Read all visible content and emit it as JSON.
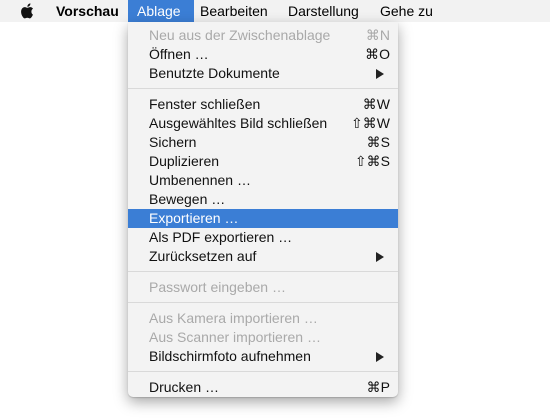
{
  "menubar": {
    "apple_icon": "apple-logo-icon",
    "app_name": "Vorschau",
    "items": [
      {
        "label": "Ablage",
        "active": true
      },
      {
        "label": "Bearbeiten",
        "active": false
      },
      {
        "label": "Darstellung",
        "active": false
      },
      {
        "label": "Gehe zu",
        "active": false
      }
    ]
  },
  "colors": {
    "highlight": "#3b7ed5",
    "menu_background": "#f3f3f3",
    "disabled_text": "#a9a9a9"
  },
  "ablage_menu": {
    "groups": [
      [
        {
          "label": "Neu aus der Zwischenablage",
          "shortcut": "⌘N",
          "enabled": false
        },
        {
          "label": "Öffnen …",
          "shortcut": "⌘O",
          "enabled": true
        },
        {
          "label": "Benutzte Dokumente",
          "submenu": true,
          "enabled": true
        }
      ],
      [
        {
          "label": "Fenster schließen",
          "shortcut": "⌘W",
          "enabled": true
        },
        {
          "label": "Ausgewähltes Bild schließen",
          "shortcut": "⇧⌘W",
          "enabled": true
        },
        {
          "label": "Sichern",
          "shortcut": "⌘S",
          "enabled": true
        },
        {
          "label": "Duplizieren",
          "shortcut": "⇧⌘S",
          "enabled": true
        },
        {
          "label": "Umbenennen …",
          "enabled": true
        },
        {
          "label": "Bewegen …",
          "enabled": true
        },
        {
          "label": "Exportieren …",
          "enabled": true,
          "highlighted": true
        },
        {
          "label": "Als PDF exportieren …",
          "enabled": true
        },
        {
          "label": "Zurücksetzen auf",
          "submenu": true,
          "enabled": true
        }
      ],
      [
        {
          "label": "Passwort eingeben …",
          "enabled": false
        }
      ],
      [
        {
          "label": "Aus Kamera importieren …",
          "enabled": false
        },
        {
          "label": "Aus Scanner importieren …",
          "enabled": false
        },
        {
          "label": "Bildschirmfoto aufnehmen",
          "submenu": true,
          "enabled": true
        }
      ],
      [
        {
          "label": "Drucken …",
          "shortcut": "⌘P",
          "enabled": true
        }
      ]
    ]
  }
}
